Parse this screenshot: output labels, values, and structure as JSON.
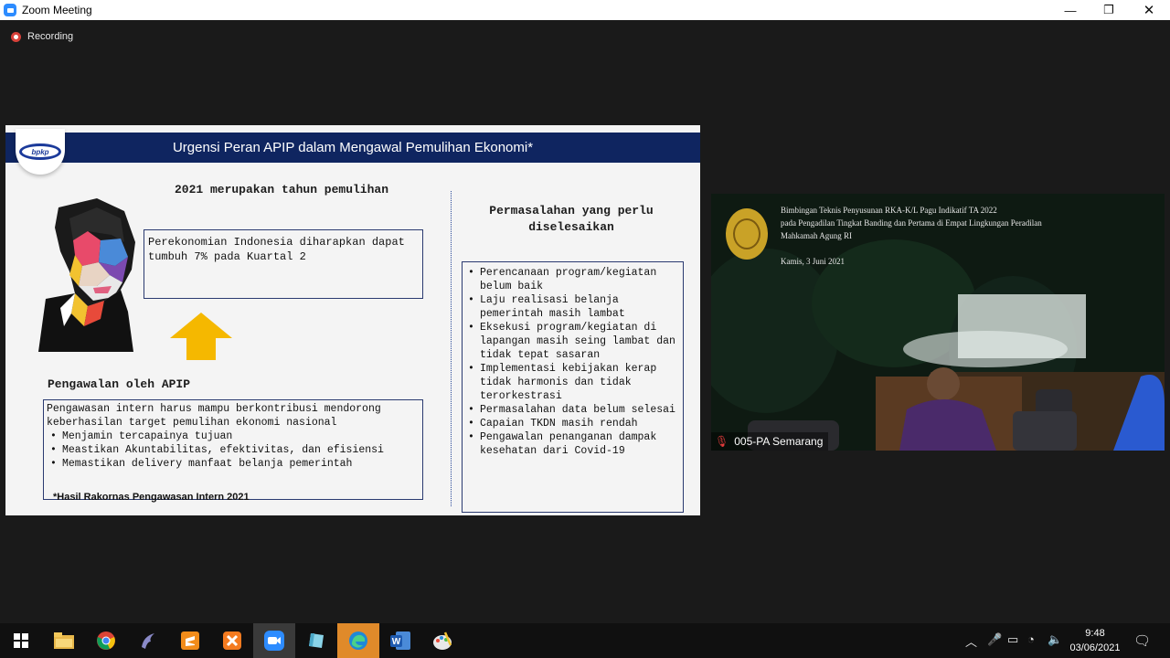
{
  "window": {
    "title": "Zoom Meeting",
    "minimize_glyph": "—",
    "maximize_glyph": "❐",
    "close_glyph": "✕"
  },
  "recording": {
    "label": "Recording"
  },
  "slide": {
    "header": "Urgensi Peran APIP dalam Mengawal Pemulihan Ekonomi*",
    "logo_text": "bpkp",
    "left_heading": "2021 merupakan tahun pemulihan",
    "growth_text": "Perekonomian Indonesia diharapkan dapat tumbuh 7% pada Kuartal 2",
    "apip_heading": "Pengawalan oleh APIP",
    "apip_intro": "Pengawasan intern harus mampu berkontribusi mendorong keberhasilan target pemulihan ekonomi nasional",
    "apip_points": [
      "Menjamin tercapainya tujuan",
      "Meastikan Akuntabilitas, efektivitas, dan efisiensi",
      "Memastikan delivery manfaat belanja pemerintah"
    ],
    "right_heading": "Permasalahan yang perlu diselesaikan",
    "problems": [
      "Perencanaan program/kegiatan belum baik",
      "Laju realisasi belanja pemerintah masih lambat",
      "Eksekusi program/kegiatan di lapangan masih seing lambat dan tidak tepat sasaran",
      "Implementasi kebijakan kerap tidak harmonis dan tidak terorkestrasi",
      "Permasalahan data belum selesai",
      "Capaian TKDN masih rendah",
      "Pengawalan penanganan dampak kesehatan dari Covid-19"
    ],
    "footnote": "*Hasil Rakornas Pengawasan Intern 2021"
  },
  "video": {
    "line1": "Bimbingan Teknis Penyusunan RKA-K/L Pagu Indikatif TA 2022",
    "line2": "pada Pengadilan Tingkat Banding dan Pertama di Empat Lingkungan Peradilan",
    "line3": "Mahkamah Agung RI",
    "date": "Kamis, 3 Juni 2021",
    "participant": "005-PA Semarang"
  },
  "taskbar": {
    "time": "9:48",
    "date": "03/06/2021",
    "icons": [
      "windows-start-icon",
      "file-explorer-icon",
      "chrome-icon",
      "dolphin-icon",
      "sublime-icon",
      "xampp-icon",
      "zoom-icon",
      "notepad-icon",
      "edge-icon",
      "word-icon",
      "paint-icon"
    ]
  },
  "colors": {
    "slide_header_bg": "#0f2560",
    "arrow": "#f5b800",
    "recording_dot": "#d8413a"
  }
}
